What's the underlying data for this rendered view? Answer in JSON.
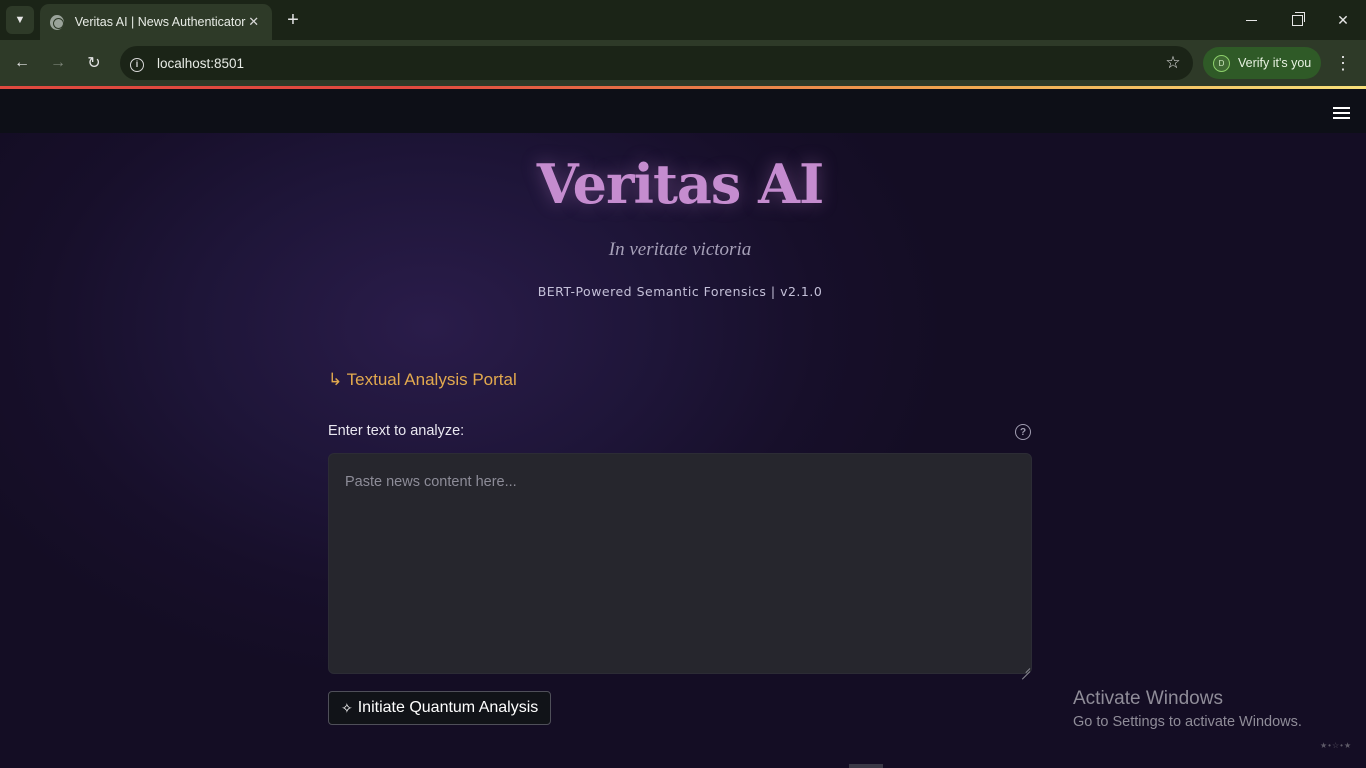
{
  "browser": {
    "tab_title": "Veritas AI | News Authenticator",
    "tab_close_glyph": "✕",
    "new_tab_glyph": "+",
    "url": "localhost:8501",
    "verify_label": "Verify it's you",
    "verify_avatar_letter": "D",
    "colors": {
      "tabbar": "#1b2417",
      "toolbar": "#2e3a28",
      "verify_pill": "#2f5a27"
    }
  },
  "app": {
    "title": "Veritas AI",
    "motto": "In veritate victoria",
    "version_line": "BERT-Powered Semantic Forensics | v2.1.0",
    "section_title": "↳ Textual Analysis Portal",
    "input_label": "Enter text to analyze:",
    "input_placeholder": "Paste news content here...",
    "input_value": "",
    "analyze_button_label": "Initiate Quantum Analysis",
    "analyze_button_icon": "✧",
    "colors": {
      "title": "#c58ccf",
      "section_title": "#e2a94e",
      "header_bar": "#0d0f17",
      "background": "#170f2a",
      "accent_gradient": [
        "#e0493f",
        "#f0a64f",
        "#f7e07a"
      ]
    }
  },
  "os_watermark": {
    "title": "Activate Windows",
    "subtitle": "Go to Settings to activate Windows."
  }
}
